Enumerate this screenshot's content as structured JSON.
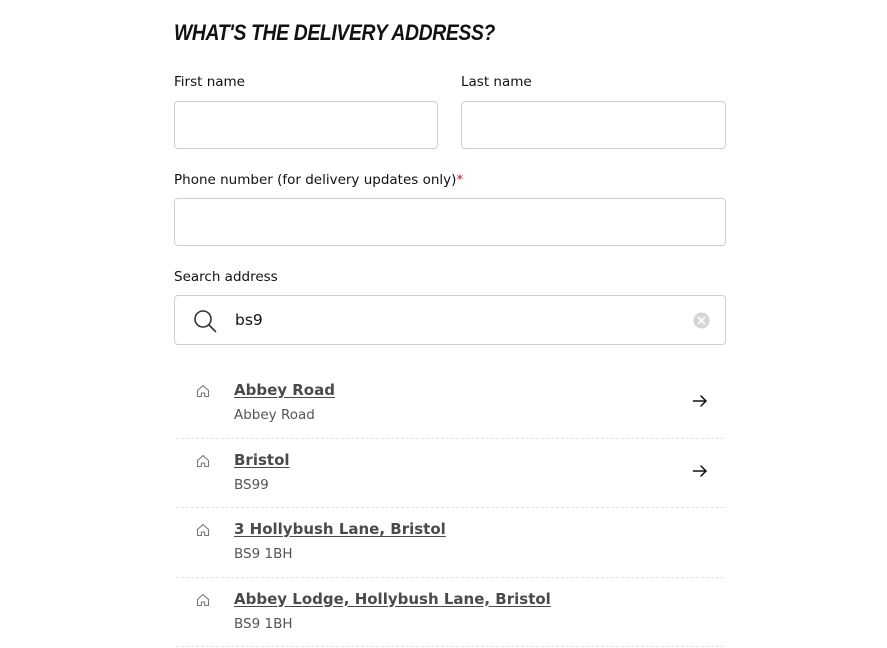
{
  "heading": "WHAT'S THE DELIVERY ADDRESS?",
  "fields": {
    "first_name": {
      "label": "First name",
      "value": ""
    },
    "last_name": {
      "label": "Last name",
      "value": ""
    },
    "phone": {
      "label": "Phone number (for delivery updates only)",
      "required_mark": "*",
      "value": ""
    }
  },
  "search": {
    "label": "Search address",
    "value": "bs9",
    "icon": "search-icon",
    "clear_icon": "clear-icon"
  },
  "results": [
    {
      "title": "Abbey Road",
      "subtitle": "Abbey Road",
      "icon": "home-icon",
      "has_arrow": true
    },
    {
      "title": "Bristol",
      "subtitle": "BS99",
      "icon": "home-icon",
      "has_arrow": true
    },
    {
      "title": "3 Hollybush Lane, Bristol",
      "subtitle": "BS9 1BH",
      "icon": "home-icon",
      "has_arrow": false
    },
    {
      "title": "Abbey Lodge, Hollybush Lane, Bristol",
      "subtitle": "BS9 1BH",
      "icon": "home-icon",
      "has_arrow": false
    }
  ],
  "colors": {
    "required": "#c8102e",
    "border": "#cfcfcf",
    "result_title": "#4a4a4a"
  }
}
